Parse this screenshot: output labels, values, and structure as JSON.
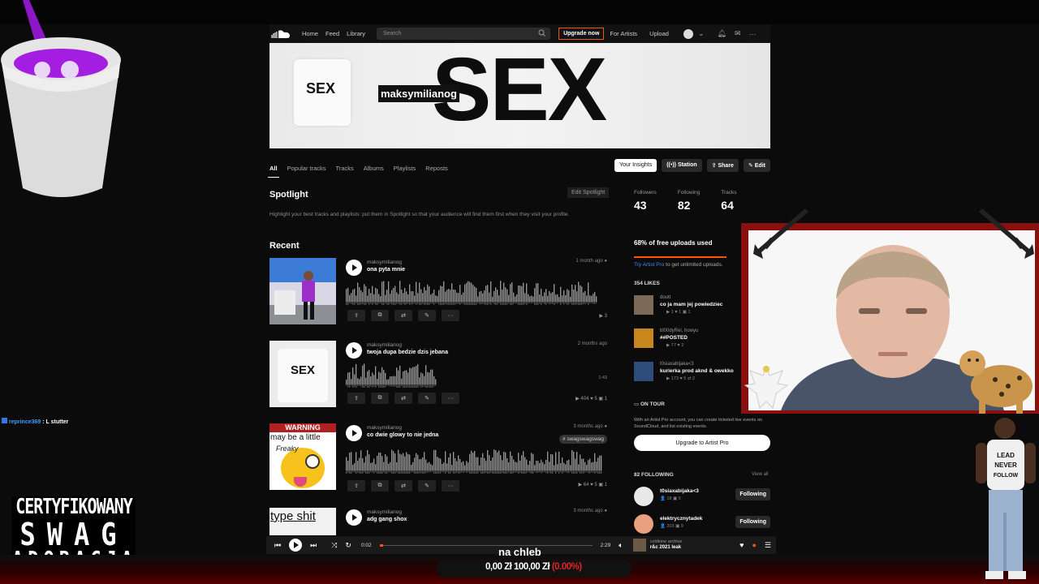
{
  "nav": {
    "home": "Home",
    "feed": "Feed",
    "library": "Library",
    "search_placeholder": "Search",
    "upgrade": "Upgrade now",
    "for_artists": "For Artists",
    "upload": "Upload"
  },
  "banner": {
    "shirt_text": "SEX",
    "big_text": "SEX",
    "username": "maksymilianog"
  },
  "tabs": {
    "items": [
      "All",
      "Popular tracks",
      "Tracks",
      "Albums",
      "Playlists",
      "Reposts"
    ],
    "insights": "Your Insights",
    "station": "Station",
    "share": "Share",
    "edit": "Edit"
  },
  "spotlight": {
    "title": "Spotlight",
    "edit": "Edit Spotlight",
    "text": "Highlight your best tracks and playlists: put them in Spotlight so that your audience will find them first when they visit your profile."
  },
  "recent": {
    "title": "Recent",
    "tracks": [
      {
        "user": "maksymilianog",
        "title": "ona pyta mnie",
        "date": "1 month ago",
        "stats": "▶ 3"
      },
      {
        "user": "maksymilianog",
        "title": "twoja dupa bedzie dzis jebana",
        "date": "2 months ago",
        "stats": "▶ 404   ♥ 5   ▣ 1",
        "duration": "1:43"
      },
      {
        "user": "maksymilianog",
        "title": "co dwie glowy to nie jedna",
        "date": "3 months ago",
        "tag": "# swagswagswag",
        "stats": "▶ 64   ♥ 5   ▣ 1"
      },
      {
        "user": "maksymilianog",
        "title": "adg gang shox",
        "date": "3 months ago"
      }
    ],
    "art3_text1": "WARNING",
    "art3_text2": "may be a little",
    "art3_text3": "Freaky",
    "art4_text": "type shit",
    "art2_text": "SEX"
  },
  "stats": {
    "followers_label": "Followers",
    "followers": "43",
    "following_label": "Following",
    "following": "82",
    "tracks_label": "Tracks",
    "tracks": "64"
  },
  "uploads": {
    "title": "68% of free uploads used",
    "used_fraction": 0.68,
    "try": "Try Artist Pro",
    "try_rest": " to get unlimited uploads."
  },
  "likes": {
    "title": "354 LIKES",
    "items": [
      {
        "user": "doutt",
        "title": "co ja mam jej powiedziec",
        "stats": "▶ 1   ♥ 1   ▣ 1"
      },
      {
        "user": "bl00dyRei, howyu",
        "title": "##POSTED",
        "stats": "▶ 77   ♥ 2"
      },
      {
        "user": "t0siaxabijaka<3",
        "title": "kurierka prod aknd & owekko",
        "stats": "▶ 173   ♥ 5   ⇄ 2"
      }
    ]
  },
  "tour": {
    "title": "ON TOUR",
    "text": "With an Artist Pro account, you can create ticketed live events on SoundCloud, and list existing events.",
    "button": "Upgrade to Artist Pro"
  },
  "following": {
    "title": "82 FOLLOWING",
    "view_all": "View all",
    "items": [
      {
        "name": "t0siaxabijaka<3",
        "stats": "👤 18   ▣ 5",
        "button": "Following"
      },
      {
        "name": "elektrycznytadek",
        "stats": "👤 203   ▣ 9",
        "button": "Following"
      }
    ]
  },
  "player": {
    "current": "0:02",
    "total": "2:29",
    "artist": "coldione archive",
    "title": "r&c 2021 leak"
  },
  "chat": {
    "user": "reprince369",
    "message": " : L stutter"
  },
  "overlay": {
    "cert_line1": "CERTYFIKOWANY",
    "cert_line2": "SWAG",
    "cert_line3": "ADORACJA",
    "caption": "na chleb",
    "money_a": "0,00 Zł",
    "money_b": "100,00 Zł",
    "money_pct": "(0.00%)",
    "shirt_text": "LEAD NEVER FOLLOW"
  },
  "colors": {
    "accent": "#ff5500",
    "background": "#121212",
    "link": "#3b8bff"
  }
}
